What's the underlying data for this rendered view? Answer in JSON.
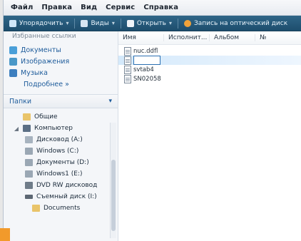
{
  "menu": [
    "Файл",
    "Правка",
    "Вид",
    "Сервис",
    "Справка"
  ],
  "toolbar": {
    "items": [
      {
        "label": "Упорядочить",
        "icon": "organize-icon"
      },
      {
        "label": "Виды",
        "icon": "views-icon"
      },
      {
        "label": "Открыть",
        "icon": "open-icon"
      },
      {
        "label": "Запись на оптический диск",
        "icon": "burn-icon"
      }
    ]
  },
  "nav": {
    "favorites_title": "Избранные ссылки",
    "favorites": [
      {
        "label": "Документы",
        "icon": "documents-icon"
      },
      {
        "label": "Изображения",
        "icon": "pictures-icon"
      },
      {
        "label": "Музыка",
        "icon": "music-icon"
      }
    ],
    "more": "Подробнее »",
    "folders_label": "Папки",
    "tree": [
      {
        "label": "Общие",
        "icon": "folder-icon",
        "level": 1
      },
      {
        "label": "Компьютер",
        "icon": "computer-icon",
        "level": 1
      },
      {
        "label": "Дисковод (A:)",
        "icon": "floppy-icon",
        "level": 2
      },
      {
        "label": "Windows (C:)",
        "icon": "drive-icon",
        "level": 2
      },
      {
        "label": "Документы (D:)",
        "icon": "drive-icon",
        "level": 2
      },
      {
        "label": "Windows1 (E:)",
        "icon": "drive-icon",
        "level": 2
      },
      {
        "label": "DVD RW дисковод",
        "icon": "dvd-icon",
        "level": 2
      },
      {
        "label": "Съемный диск (I:)",
        "icon": "usb-icon",
        "level": 2
      },
      {
        "label": "Documents",
        "icon": "folder-icon",
        "level": 3
      }
    ]
  },
  "columns": [
    "Имя",
    "Исполнит...",
    "Альбом",
    "№"
  ],
  "files": [
    {
      "name": "nuc.ddfl",
      "selected": false
    },
    {
      "name": "",
      "selected": true
    },
    {
      "name": "svtab4",
      "selected": false
    },
    {
      "name": "SN02058",
      "selected": false
    }
  ]
}
